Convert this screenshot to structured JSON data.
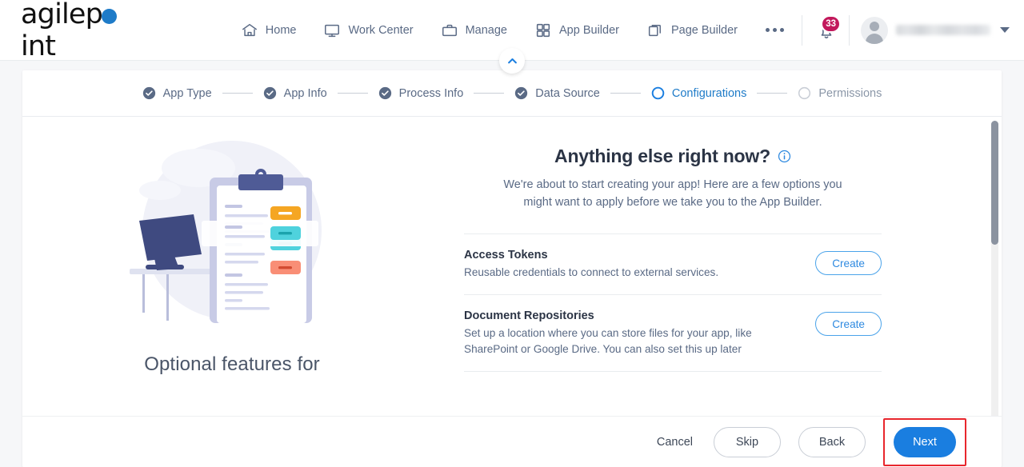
{
  "brand": {
    "name_part1": "agilep",
    "name_part2": "int",
    "dot_color": "#1e7bc8"
  },
  "header": {
    "nav": [
      {
        "label": "Home",
        "icon": "home-icon"
      },
      {
        "label": "Work Center",
        "icon": "monitor-icon"
      },
      {
        "label": "Manage",
        "icon": "briefcase-icon"
      },
      {
        "label": "App Builder",
        "icon": "grid-icon"
      },
      {
        "label": "Page Builder",
        "icon": "copy-pages-icon"
      }
    ],
    "more_label": "",
    "notifications": {
      "count": "33",
      "icon": "bell-icon",
      "badge_color": "#c2185b"
    },
    "user": {
      "name": "",
      "icon": "avatar-icon",
      "chevron": "chevron-down-icon"
    },
    "collapse": {
      "icon": "chevron-up-icon"
    }
  },
  "stepper": {
    "steps": [
      {
        "label": "App Type",
        "state": "complete"
      },
      {
        "label": "App Info",
        "state": "complete"
      },
      {
        "label": "Process Info",
        "state": "complete"
      },
      {
        "label": "Data Source",
        "state": "complete"
      },
      {
        "label": "Configurations",
        "state": "active"
      },
      {
        "label": "Permissions",
        "state": "pending"
      }
    ]
  },
  "illustration": {
    "caption": "Optional features for",
    "alt": "desk-clipboard-illustration"
  },
  "main": {
    "title": "Anything else right now?",
    "info_icon": "info-icon",
    "subtitle": "We're about to start creating your app! Here are a few options you might want to apply before we take you to the App Builder.",
    "options": [
      {
        "name": "Access Tokens",
        "description": "Reusable credentials to connect to external services.",
        "action_label": "Create"
      },
      {
        "name": "Document Repositories",
        "description": "Set up a location where you can store files for your app, like SharePoint or Google Drive. You can also set this up later",
        "action_label": "Create"
      }
    ]
  },
  "footer": {
    "cancel_label": "Cancel",
    "skip_label": "Skip",
    "back_label": "Back",
    "next_label": "Next",
    "next_highlight_color": "#e8262d",
    "next_bg_color": "#1a7ee0"
  }
}
